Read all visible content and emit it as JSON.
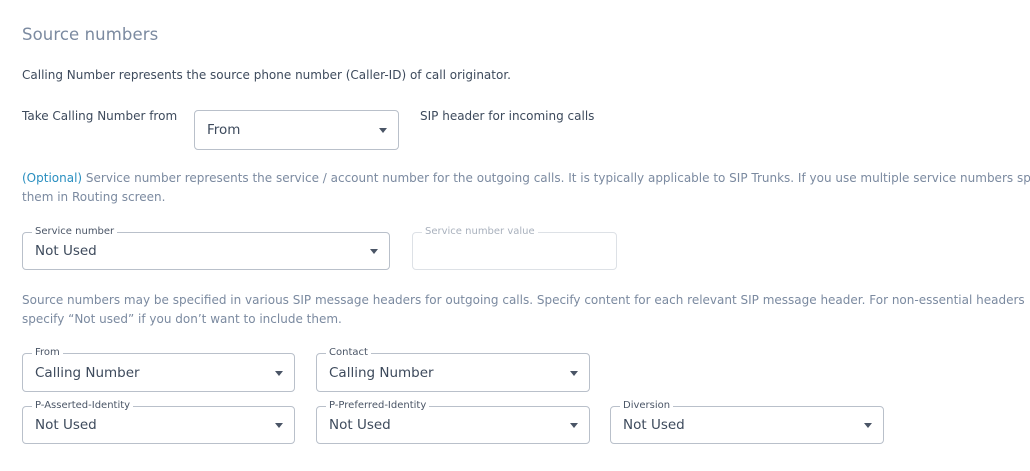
{
  "section": {
    "title": "Source numbers"
  },
  "calling": {
    "description": "Calling Number represents the source phone number (Caller-ID) of call originator.",
    "take_label": "Take Calling Number from",
    "from_value": "From",
    "sip_suffix": "SIP header for incoming calls"
  },
  "service": {
    "optional_tag": "(Optional)",
    "description_line1": " Service number represents the service / account number for the outgoing calls. It is typically applicable to SIP Trunks. If you use multiple service numbers specify",
    "description_line2": "them in Routing screen.",
    "number_label": "Service number",
    "number_value": "Not Used",
    "value_label": "Service number value",
    "value_text": ""
  },
  "headers": {
    "description_line1": "Source numbers may be specified in various SIP message headers for outgoing calls. Specify content for each relevant SIP message header. For non-essential headers",
    "description_line2": "specify “Not used” if you don’t want to include them.",
    "from": {
      "label": "From",
      "value": "Calling Number"
    },
    "contact": {
      "label": "Contact",
      "value": "Calling Number"
    },
    "pai": {
      "label": "P-Asserted-Identity",
      "value": "Not Used"
    },
    "ppi": {
      "label": "P-Preferred-Identity",
      "value": "Not Used"
    },
    "diversion": {
      "label": "Diversion",
      "value": "Not Used"
    }
  },
  "icons": {
    "dropdown": "chevron-down-icon"
  }
}
